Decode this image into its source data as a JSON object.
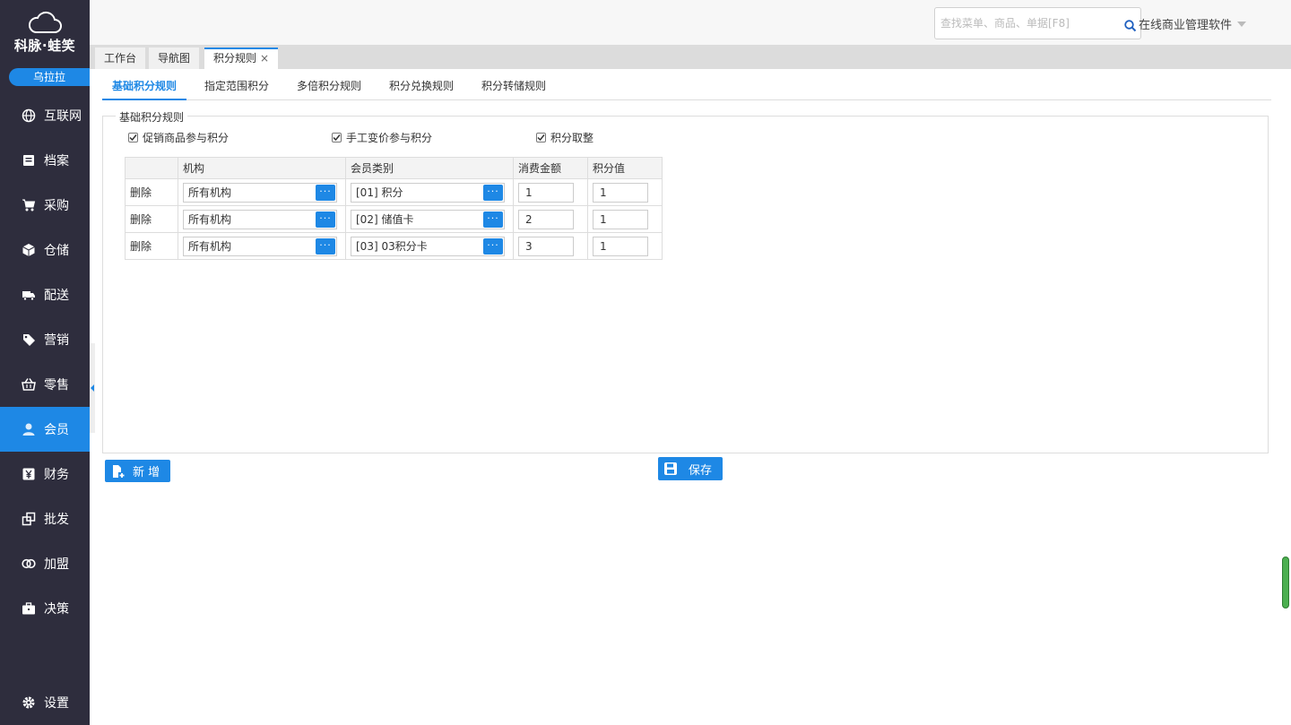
{
  "brand": {
    "name": "科脉·蛙笑",
    "user": "乌拉拉"
  },
  "nav": {
    "items": [
      {
        "label": "互联网",
        "icon": "globe-icon"
      },
      {
        "label": "档案",
        "icon": "file-icon"
      },
      {
        "label": "采购",
        "icon": "cart-icon"
      },
      {
        "label": "仓储",
        "icon": "box-icon"
      },
      {
        "label": "配送",
        "icon": "truck-icon"
      },
      {
        "label": "营销",
        "icon": "tag-icon"
      },
      {
        "label": "零售",
        "icon": "basket-icon"
      },
      {
        "label": "会员",
        "icon": "user-icon",
        "active": true
      },
      {
        "label": "财务",
        "icon": "yen-icon"
      },
      {
        "label": "批发",
        "icon": "copy-icon"
      },
      {
        "label": "加盟",
        "icon": "rings-icon"
      },
      {
        "label": "决策",
        "icon": "briefcase-icon"
      }
    ],
    "settings": {
      "label": "设置",
      "icon": "gear-icon"
    }
  },
  "topbar": {
    "search_placeholder": "查找菜单、商品、单据[F8]",
    "company": "在线商业管理软件"
  },
  "tabs": [
    {
      "label": "工作台"
    },
    {
      "label": "导航图"
    },
    {
      "label": "积分规则",
      "active": true,
      "close": "×"
    }
  ],
  "subtabs": [
    {
      "label": "基础积分规则",
      "active": true
    },
    {
      "label": "指定范围积分"
    },
    {
      "label": "多倍积分规则"
    },
    {
      "label": "积分兑换规则"
    },
    {
      "label": "积分转储规则"
    }
  ],
  "section": {
    "legend": "基础积分规则",
    "checkboxes": [
      {
        "label": "促销商品参与积分",
        "checked": true
      },
      {
        "label": "手工变价参与积分",
        "checked": true
      },
      {
        "label": "积分取整",
        "checked": true
      }
    ]
  },
  "table": {
    "headers": [
      "",
      "机构",
      "会员类别",
      "消费金额",
      "积分值"
    ],
    "picker_button": "···",
    "rows": [
      {
        "action": "删除",
        "org": "所有机构",
        "member_type": "[01] 积分",
        "amount": "1",
        "points": "1"
      },
      {
        "action": "删除",
        "org": "所有机构",
        "member_type": "[02] 储值卡",
        "amount": "2",
        "points": "1"
      },
      {
        "action": "删除",
        "org": "所有机构",
        "member_type": "[03] 03积分卡",
        "amount": "3",
        "points": "1"
      }
    ]
  },
  "buttons": {
    "add": "新 增",
    "save": "保存"
  },
  "colors": {
    "sidebar": "#2e2d3d",
    "accent": "#1e88e5"
  }
}
